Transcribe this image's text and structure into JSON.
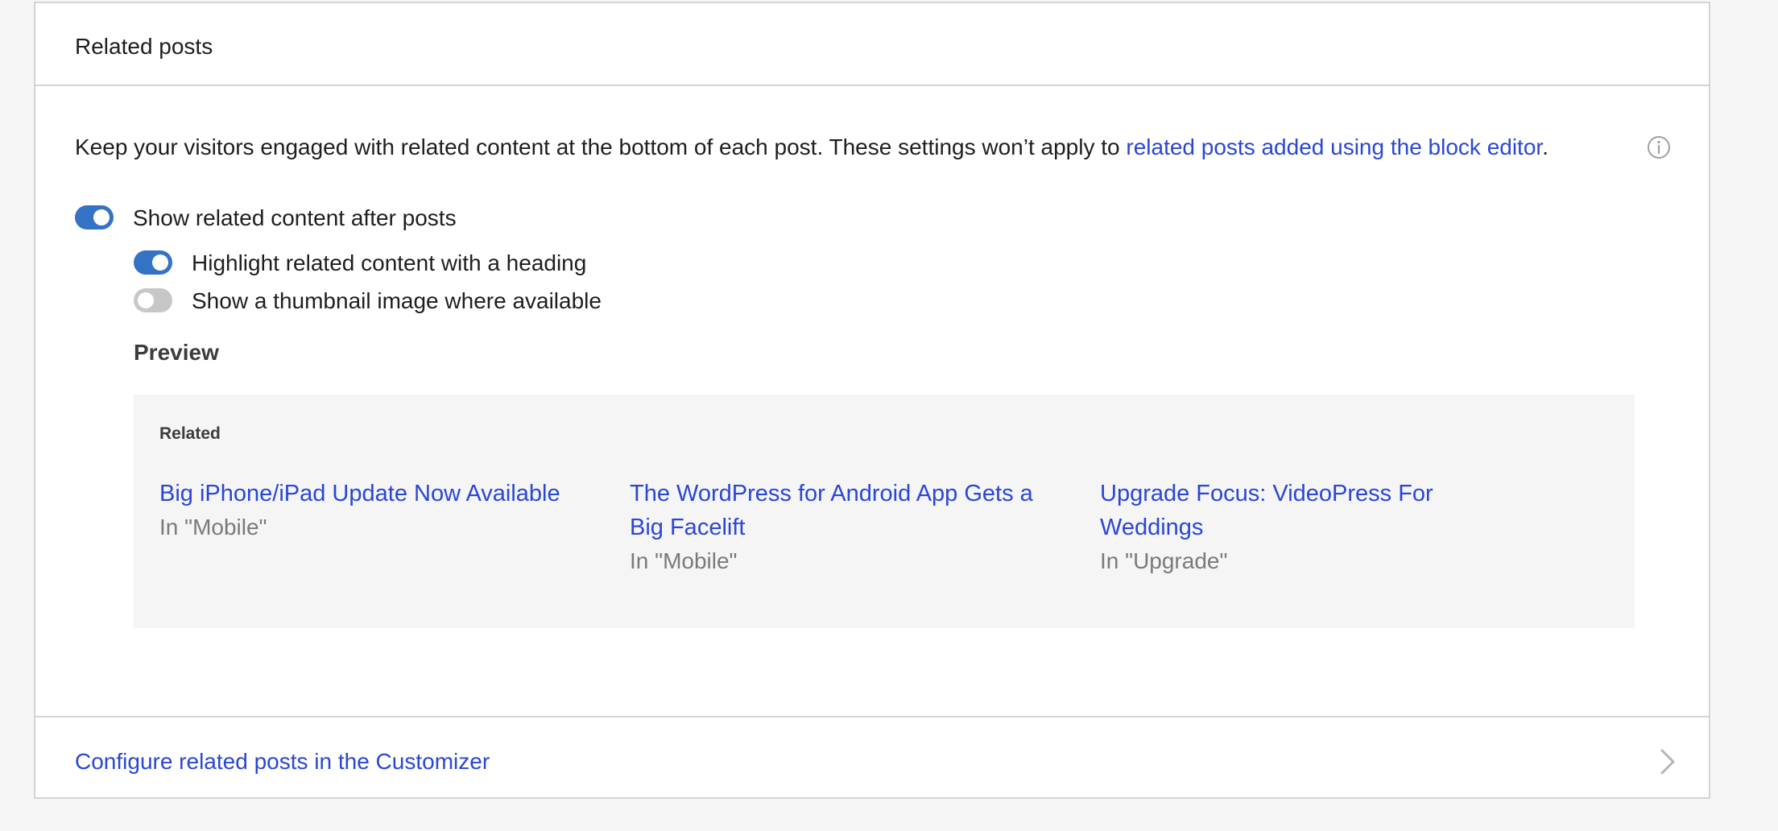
{
  "card": {
    "title": "Related posts",
    "description_prefix": "Keep your visitors engaged with related content at the bottom of each post. These settings won’t apply to ",
    "description_link": "related posts added using the block editor",
    "description_suffix": ".",
    "info_icon": "info-circle-icon"
  },
  "toggles": [
    {
      "label": "Show related content after posts",
      "enabled": true
    },
    {
      "label": "Highlight related content with a heading",
      "enabled": true
    },
    {
      "label": "Show a thumbnail image where available",
      "enabled": false
    }
  ],
  "preview": {
    "heading": "Preview",
    "related_label": "Related",
    "posts": [
      {
        "title": "Big iPhone/iPad Update Now Available",
        "category": "In \"Mobile\""
      },
      {
        "title": "The WordPress for Android App Gets a Big Facelift",
        "category": "In \"Mobile\""
      },
      {
        "title": "Upgrade Focus: VideoPress For Weddings",
        "category": "In \"Upgrade\""
      }
    ]
  },
  "footer": {
    "link": "Configure related posts in the Customizer",
    "icon": "chevron-right-icon"
  },
  "colors": {
    "accent": "#3372c4",
    "link": "#2a46d6",
    "toggle_off": "#c7c7c7"
  }
}
